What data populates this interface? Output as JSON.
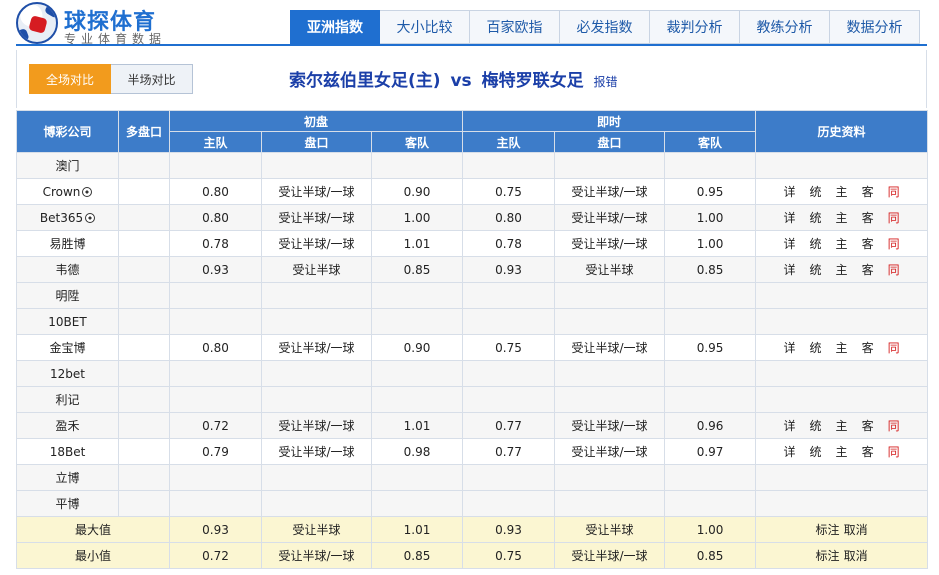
{
  "logo": {
    "title": "球探体育",
    "subtitle": "专业体育数据"
  },
  "tabs": [
    "亚洲指数",
    "大小比较",
    "百家欧指",
    "必发指数",
    "裁判分析",
    "教练分析",
    "数据分析"
  ],
  "active_tab": 0,
  "toggle": {
    "full": "全场对比",
    "half": "半场对比"
  },
  "match": {
    "home": "索尔兹伯里女足(主)",
    "vs": "vs",
    "away": "梅特罗联女足",
    "report": "报错"
  },
  "headers": {
    "company": "博彩公司",
    "multi": "多盘口",
    "initial": "初盘",
    "live": "即时",
    "history": "历史资料",
    "home": "主队",
    "line": "盘口",
    "away": "客队"
  },
  "rows": [
    {
      "company": "澳门",
      "icon": false,
      "odds": null
    },
    {
      "company": "Crown",
      "icon": true,
      "odds": [
        "0.80",
        "受让半球/一球",
        "0.90",
        "0.75",
        "受让半球/一球",
        "0.95"
      ]
    },
    {
      "company": "Bet365",
      "icon": true,
      "odds": [
        "0.80",
        "受让半球/一球",
        "1.00",
        "0.80",
        "受让半球/一球",
        "1.00"
      ]
    },
    {
      "company": "易胜博",
      "icon": false,
      "odds": [
        "0.78",
        "受让半球/一球",
        "1.01",
        "0.78",
        "受让半球/一球",
        "1.00"
      ]
    },
    {
      "company": "韦德",
      "icon": false,
      "odds": [
        "0.93",
        "受让半球",
        "0.85",
        "0.93",
        "受让半球",
        "0.85"
      ]
    },
    {
      "company": "明陞",
      "icon": false,
      "odds": null
    },
    {
      "company": "10BET",
      "icon": false,
      "odds": null
    },
    {
      "company": "金宝博",
      "icon": false,
      "odds": [
        "0.80",
        "受让半球/一球",
        "0.90",
        "0.75",
        "受让半球/一球",
        "0.95"
      ]
    },
    {
      "company": "12bet",
      "icon": false,
      "odds": null
    },
    {
      "company": "利记",
      "icon": false,
      "odds": null
    },
    {
      "company": "盈禾",
      "icon": false,
      "odds": [
        "0.72",
        "受让半球/一球",
        "1.01",
        "0.77",
        "受让半球/一球",
        "0.96"
      ]
    },
    {
      "company": "18Bet",
      "icon": false,
      "odds": [
        "0.79",
        "受让半球/一球",
        "0.98",
        "0.77",
        "受让半球/一球",
        "0.97"
      ]
    },
    {
      "company": "立博",
      "icon": false,
      "odds": null
    },
    {
      "company": "平博",
      "icon": false,
      "odds": null
    }
  ],
  "history_links": [
    "详",
    "统",
    "主",
    "客",
    "同"
  ],
  "summary": [
    {
      "label": "最大值",
      "odds": [
        "0.93",
        "受让半球",
        "1.01",
        "0.93",
        "受让半球",
        "1.00"
      ]
    },
    {
      "label": "最小值",
      "odds": [
        "0.72",
        "受让半球/一球",
        "0.85",
        "0.75",
        "受让半球/一球",
        "0.85"
      ]
    }
  ],
  "summary_actions": {
    "mark": "标注",
    "cancel": "取消"
  },
  "colors": {
    "header_blue": "#3d7cc9",
    "active_tab": "#1f6fd0",
    "toggle_on": "#f29b1d",
    "title": "#1b3fa8",
    "red": "#d41b1b",
    "summary_bg": "#fbf6d2"
  }
}
